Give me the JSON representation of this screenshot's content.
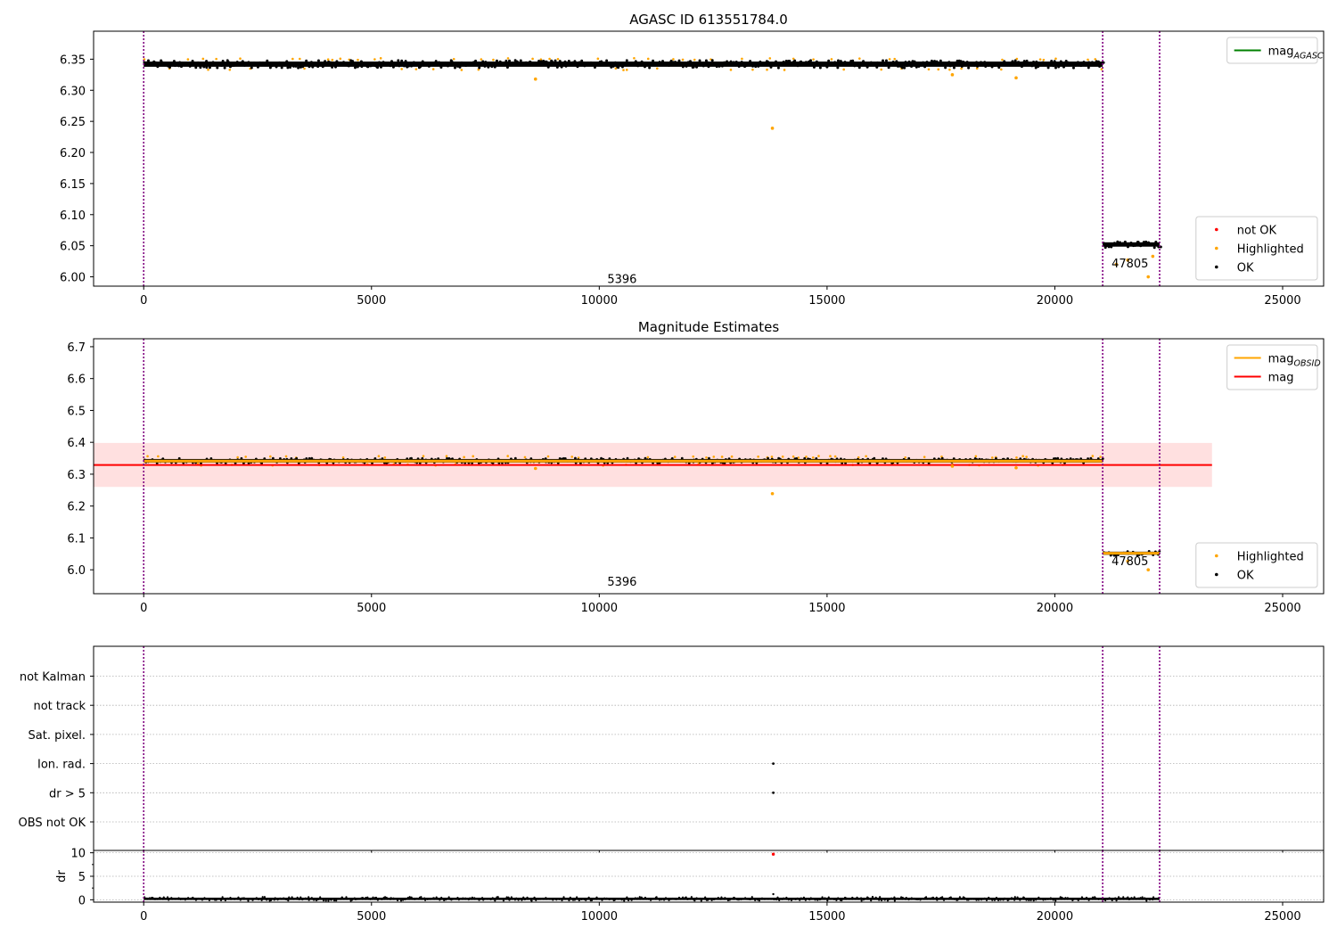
{
  "chart_data": [
    {
      "type": "scatter",
      "title": "AGASC ID 613551784.0",
      "xlim": [
        -1100,
        25900
      ],
      "ylim": [
        5.985,
        6.395
      ],
      "x_ticks": [
        0,
        5000,
        10000,
        15000,
        20000,
        25000
      ],
      "x_tick_labels": [
        "0",
        "5000",
        "10000",
        "15000",
        "20000",
        "25000"
      ],
      "y_ticks": [
        6.0,
        6.05,
        6.1,
        6.15,
        6.2,
        6.25,
        6.3,
        6.35
      ],
      "y_tick_labels": [
        "6.00",
        "6.05",
        "6.10",
        "6.15",
        "6.20",
        "6.25",
        "6.30",
        "6.35"
      ],
      "obsid_boundaries": [
        0,
        21050,
        22300
      ],
      "obsid_labels": [
        {
          "text": "5396",
          "x": 10500,
          "y": 5.99
        },
        {
          "text": "47805",
          "x": 21650,
          "y": 6.015
        }
      ],
      "bands": [
        {
          "x_start": 0,
          "x_end": 21050,
          "center": 6.342,
          "spread": 0.006
        },
        {
          "x_start": 21050,
          "x_end": 22300,
          "center": 6.052,
          "spread": 0.005
        }
      ],
      "highlighted_outliers": [
        {
          "x": 8600,
          "y": 6.318
        },
        {
          "x": 13800,
          "y": 6.239
        },
        {
          "x": 17750,
          "y": 6.325
        },
        {
          "x": 19150,
          "y": 6.32
        },
        {
          "x": 21600,
          "y": 6.027
        },
        {
          "x": 22050,
          "y": 6.0
        },
        {
          "x": 22150,
          "y": 6.033
        },
        {
          "x": 21350,
          "y": 6.02
        }
      ],
      "legends": [
        {
          "position": "upper-right",
          "entries": [
            {
              "label": "mag",
              "sub": "AGASC",
              "kind": "line",
              "color": "#008000"
            }
          ]
        },
        {
          "position": "lower-right",
          "entries": [
            {
              "label": "not OK",
              "kind": "dot",
              "color": "#ff0000"
            },
            {
              "label": "Highlighted",
              "kind": "dot",
              "color": "#ffa500"
            },
            {
              "label": "OK",
              "kind": "dot",
              "color": "#000000"
            }
          ]
        }
      ]
    },
    {
      "type": "scatter",
      "title": "Magnitude Estimates",
      "xlim": [
        -1100,
        25900
      ],
      "ylim": [
        5.925,
        6.725
      ],
      "x_ticks": [
        0,
        5000,
        10000,
        15000,
        20000,
        25000
      ],
      "x_tick_labels": [
        "0",
        "5000",
        "10000",
        "15000",
        "20000",
        "25000"
      ],
      "y_ticks": [
        6.0,
        6.1,
        6.2,
        6.3,
        6.4,
        6.5,
        6.6,
        6.7
      ],
      "y_tick_labels": [
        "6.0",
        "6.1",
        "6.2",
        "6.3",
        "6.4",
        "6.5",
        "6.6",
        "6.7"
      ],
      "obsid_boundaries": [
        0,
        21050,
        22300
      ],
      "obsid_labels": [
        {
          "text": "5396",
          "x": 10500,
          "y": 5.95
        },
        {
          "text": "47805",
          "x": 21650,
          "y": 6.015
        }
      ],
      "mag": 6.329,
      "mag_band": [
        6.26,
        6.398
      ],
      "mag_x_range": [
        -1100,
        23450
      ],
      "obsid_mag": [
        {
          "x_start": 0,
          "x_end": 21050,
          "value": 6.341
        },
        {
          "x_start": 21050,
          "x_end": 22300,
          "value": 6.052
        }
      ],
      "bands": [
        {
          "x_start": 0,
          "x_end": 21050,
          "center": 6.342,
          "spread": 0.008
        },
        {
          "x_start": 21050,
          "x_end": 22300,
          "center": 6.052,
          "spread": 0.007
        }
      ],
      "highlighted_outliers": [
        {
          "x": 8600,
          "y": 6.318
        },
        {
          "x": 13800,
          "y": 6.239
        },
        {
          "x": 17750,
          "y": 6.325
        },
        {
          "x": 19150,
          "y": 6.32
        },
        {
          "x": 21600,
          "y": 6.027
        },
        {
          "x": 22050,
          "y": 6.0
        }
      ],
      "legends": [
        {
          "position": "upper-right",
          "entries": [
            {
              "label": "mag",
              "sub": "OBSID",
              "kind": "line",
              "color": "#ffa500"
            },
            {
              "label": "mag",
              "kind": "line",
              "color": "#ff0000"
            }
          ]
        },
        {
          "position": "lower-right",
          "entries": [
            {
              "label": "Highlighted",
              "kind": "dot",
              "color": "#ffa500"
            },
            {
              "label": "OK",
              "kind": "dot",
              "color": "#000000"
            }
          ]
        }
      ]
    },
    {
      "type": "scatter",
      "xlim": [
        -1100,
        25900
      ],
      "categories": [
        "OBS not OK",
        "dr > 5",
        "Ion. rad.",
        "Sat. pixel.",
        "not track",
        "not Kalman"
      ],
      "obsid_boundaries": [
        0,
        21050,
        22300
      ],
      "flag_points": [
        {
          "x": 13820,
          "category": "Ion. rad."
        },
        {
          "x": 13820,
          "category": "dr > 5"
        }
      ]
    },
    {
      "type": "scatter",
      "xlim": [
        -1100,
        25900
      ],
      "ylim": [
        -0.5,
        10.5
      ],
      "ylabel": "dr",
      "x_ticks": [
        0,
        5000,
        10000,
        15000,
        20000,
        25000
      ],
      "x_tick_labels": [
        "0",
        "5000",
        "10000",
        "15000",
        "20000",
        "25000"
      ],
      "y_ticks": [
        0,
        5,
        10
      ],
      "y_tick_labels": [
        "0",
        "5",
        "10"
      ],
      "obsid_boundaries": [
        0,
        21050,
        22300
      ],
      "band": {
        "x_start": 0,
        "x_end": 22300,
        "center": 0.2,
        "spread": 0.25
      },
      "not_ok_points": [
        {
          "x": 13820,
          "y": 9.7
        }
      ],
      "extra_points": [
        {
          "x": 13820,
          "y": 1.2
        },
        {
          "x": 16000,
          "y": 0.6
        }
      ]
    }
  ]
}
